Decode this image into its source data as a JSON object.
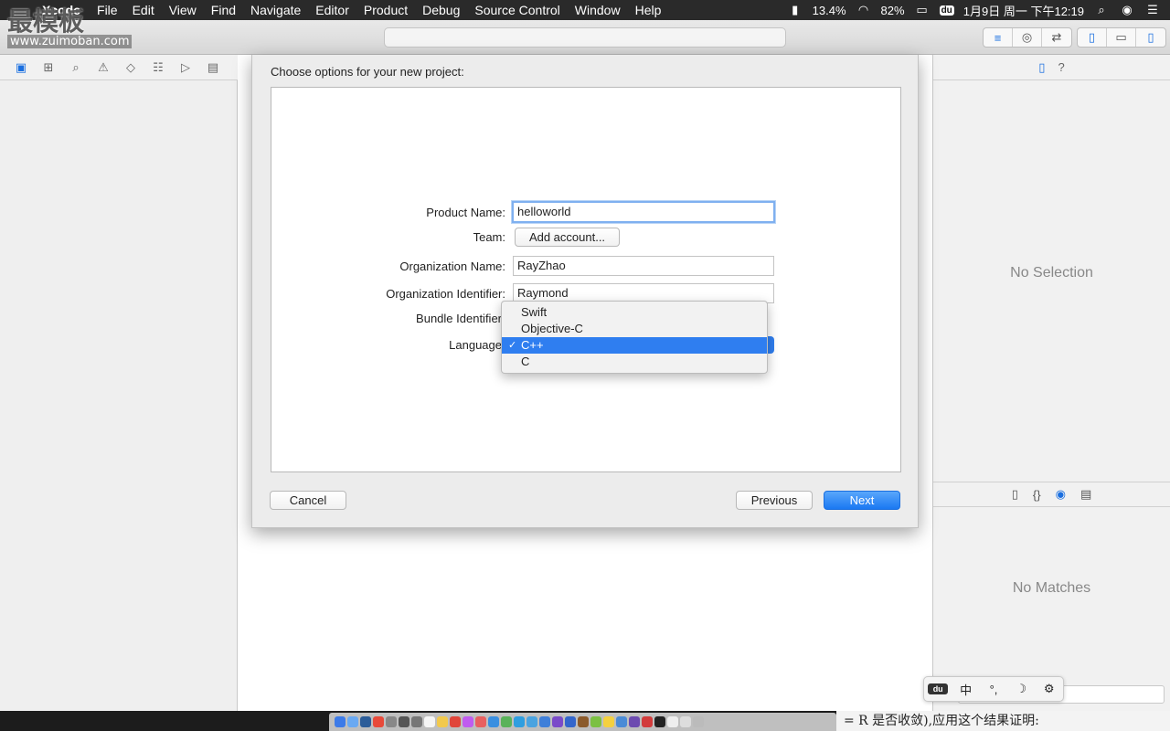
{
  "menubar": {
    "apple": "",
    "app_name": "Xcode",
    "items": [
      "File",
      "Edit",
      "View",
      "Find",
      "Navigate",
      "Editor",
      "Product",
      "Debug",
      "Source Control",
      "Window",
      "Help"
    ],
    "status": {
      "cpu": "13.4%",
      "battery": "82%",
      "ime_badge": "du",
      "clock": "1月9日 周一 下午12:19"
    },
    "icons": [
      "cpu-meter-icon",
      "wifi-icon",
      "battery-icon",
      "baidu-ime-icon",
      "spotlight-icon",
      "siri-icon",
      "notification-center-icon"
    ]
  },
  "watermark": {
    "big": "最模板",
    "url": "www.zuimoban.com"
  },
  "sheet": {
    "title": "Choose options for your new project:",
    "fields": {
      "product_name_label": "Product Name:",
      "product_name_value": "helloworld",
      "team_label": "Team:",
      "add_account": "Add account...",
      "org_name_label": "Organization Name:",
      "org_name_value": "RayZhao",
      "org_id_label": "Organization Identifier:",
      "org_id_value": "Raymond",
      "bundle_id_label": "Bundle Identifier",
      "language_label": "Language"
    },
    "language_options": [
      "Swift",
      "Objective-C",
      "C++",
      "C"
    ],
    "language_selected": "C++",
    "check": "✓",
    "buttons": {
      "cancel": "Cancel",
      "previous": "Previous",
      "next": "Next"
    }
  },
  "inspector": {
    "no_selection": "No Selection",
    "no_matches": "No Matches"
  },
  "ime_bar": {
    "badge": "du",
    "chinese": "中",
    "punct": "°,",
    "moon": "☽",
    "gear": "⚙"
  },
  "dock": {
    "caption": "= R 是否收敛),应用这个结果证明:"
  },
  "colors": {
    "accent": "#1a78f2",
    "selected": "#2f7ef0",
    "menubar": "#2a2a2a"
  }
}
